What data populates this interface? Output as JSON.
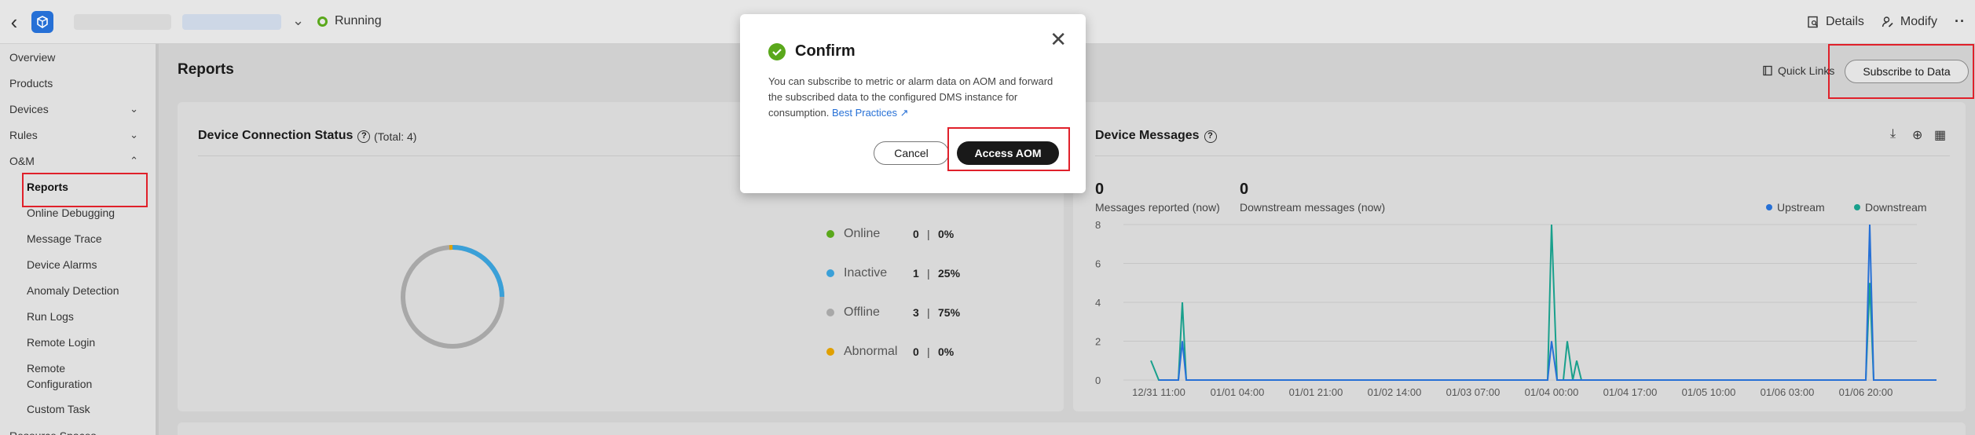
{
  "topbar": {
    "status": "Running",
    "actions": [
      {
        "label": "Details"
      },
      {
        "label": "Modify"
      }
    ]
  },
  "sidebar": {
    "items": [
      {
        "label": "Overview"
      },
      {
        "label": "Products"
      },
      {
        "label": "Devices"
      },
      {
        "label": "Rules"
      },
      {
        "label": "O&M"
      },
      {
        "label": "Reports"
      },
      {
        "label": "Online Debugging"
      },
      {
        "label": "Message Trace"
      },
      {
        "label": "Device Alarms"
      },
      {
        "label": "Anomaly Detection"
      },
      {
        "label": "Run Logs"
      },
      {
        "label": "Remote Login"
      },
      {
        "label": "Remote Configuration"
      },
      {
        "label": "Custom Task"
      },
      {
        "label": "Resource Spaces"
      }
    ]
  },
  "main": {
    "title": "Reports",
    "quick_links": "Quick Links",
    "subscribe_label": "Subscribe to Data"
  },
  "connection_card": {
    "title": "Device Connection Status",
    "total": "(Total: 4)",
    "legend": [
      {
        "name": "Online",
        "count": "0",
        "sep": "|",
        "pct": "0%",
        "color": "#5aa81b"
      },
      {
        "name": "Inactive",
        "count": "1",
        "sep": "|",
        "pct": "25%",
        "color": "#3aa0d8"
      },
      {
        "name": "Offline",
        "count": "3",
        "sep": "|",
        "pct": "75%",
        "color": "#a8a8a8"
      },
      {
        "name": "Abnormal",
        "count": "0",
        "sep": "|",
        "pct": "0%",
        "color": "#e0a000"
      }
    ]
  },
  "messages_card": {
    "title": "Device Messages",
    "reported_value": "0",
    "reported_label": "Messages reported (now)",
    "downstream_value": "0",
    "downstream_label": "Downstream messages (now)"
  },
  "modal": {
    "title": "Confirm",
    "body": "You can subscribe to metric or alarm data on AOM and forward the subscribed data to the configured DMS instance for consumption.",
    "link": "Best Practices",
    "cancel": "Cancel",
    "confirm": "Access AOM"
  },
  "chart_data": {
    "type": "line",
    "x_ticks": [
      "12/31 11:00",
      "01/01 04:00",
      "01/01 21:00",
      "01/02 14:00",
      "01/03 07:00",
      "01/04 00:00",
      "01/04 17:00",
      "01/05 10:00",
      "01/06 03:00",
      "01/06 20:00"
    ],
    "ylim": [
      0,
      8
    ],
    "y_ticks": [
      0,
      2,
      4,
      6,
      8
    ],
    "colors": {
      "upstream": "#2670d6",
      "downstream": "#19a08c"
    },
    "series": [
      {
        "name": "Upstream",
        "points": [
          [
            0.0,
            0
          ],
          [
            0.25,
            0
          ],
          [
            0.3,
            2
          ],
          [
            0.35,
            0
          ],
          [
            4.95,
            0
          ],
          [
            5.0,
            2
          ],
          [
            5.07,
            0
          ],
          [
            9.0,
            0
          ],
          [
            9.05,
            8
          ],
          [
            9.1,
            0
          ],
          [
            9.9,
            0
          ]
        ]
      },
      {
        "name": "Downstream",
        "points": [
          [
            -0.1,
            1
          ],
          [
            0.0,
            0
          ],
          [
            0.25,
            0
          ],
          [
            0.3,
            4
          ],
          [
            0.35,
            0
          ],
          [
            4.95,
            0
          ],
          [
            5.0,
            8
          ],
          [
            5.07,
            0
          ],
          [
            5.15,
            0
          ],
          [
            5.2,
            2
          ],
          [
            5.27,
            0
          ],
          [
            5.32,
            1
          ],
          [
            5.38,
            0
          ],
          [
            9.0,
            0
          ],
          [
            9.05,
            5
          ],
          [
            9.1,
            0
          ],
          [
            9.9,
            0
          ]
        ]
      }
    ]
  }
}
